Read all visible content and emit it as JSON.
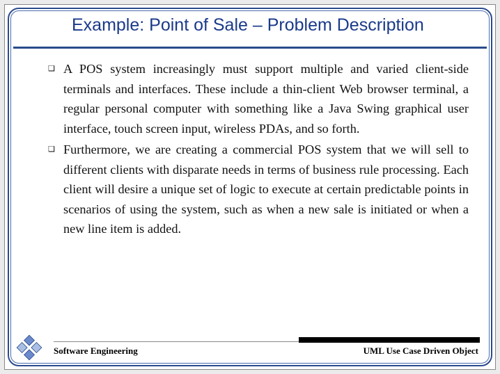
{
  "title": "Example: Point of Sale – Problem Description",
  "bullets": [
    "A POS system increasingly must support multiple and varied client-side terminals and interfaces. These include a thin-client Web browser terminal, a regular personal computer with something like a Java Swing graphical user interface, touch screen input, wireless PDAs, and so forth.",
    "Furthermore, we are creating a commercial POS system that we will sell to different clients with disparate needs in terms of business rule processing. Each client will desire a unique set of logic to execute at certain predictable points in scenarios of using the system, such as when a new sale is initiated or when a new line item is added."
  ],
  "footer": {
    "left": "Software Engineering",
    "right": "UML Use Case Driven Object"
  }
}
